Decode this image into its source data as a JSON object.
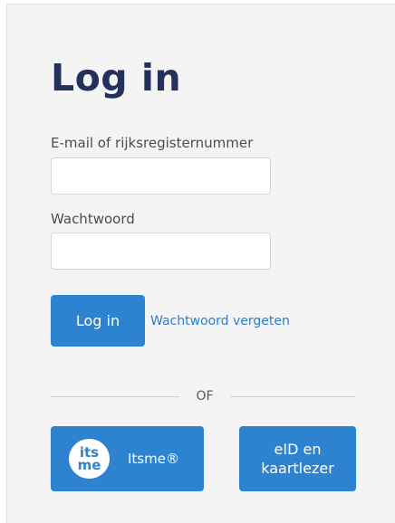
{
  "login": {
    "title": "Log in",
    "email_label": "E-mail of rijksregisternummer",
    "email_value": "",
    "password_label": "Wachtwoord",
    "password_value": "",
    "submit_label": "Log in",
    "forgot_link": "Wachtwoord vergeten"
  },
  "divider": {
    "text": "OF"
  },
  "alternatives": {
    "itsme": {
      "logo_top": "its",
      "logo_bottom": "me",
      "label": "Itsme®"
    },
    "eid": {
      "line1": "eID en",
      "line2": "kaartlezer"
    }
  },
  "colors": {
    "primary_button": "#2d83cf",
    "title": "#23315b",
    "link": "#2d7dcc",
    "panel_bg": "#f4f4f5"
  }
}
